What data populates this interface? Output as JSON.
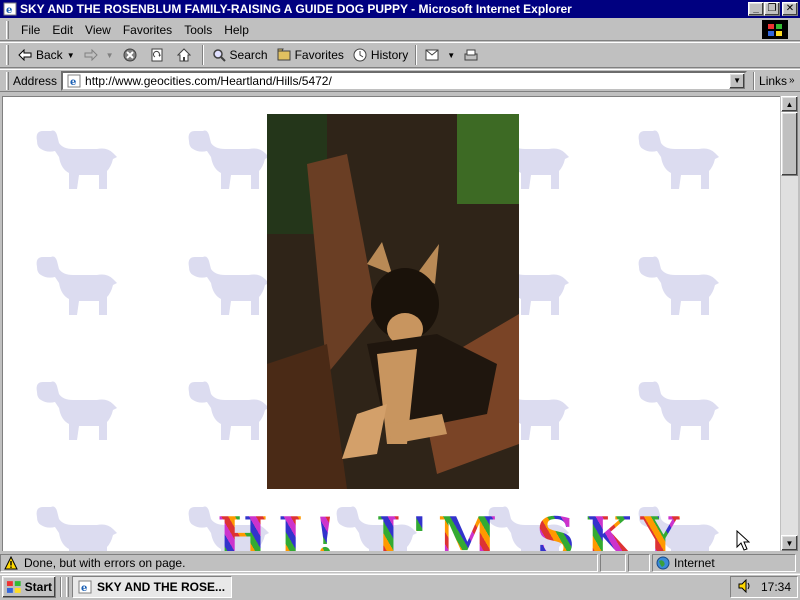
{
  "window": {
    "title": "SKY AND THE ROSENBLUM FAMILY-RAISING A GUIDE DOG PUPPY - Microsoft Internet Explorer",
    "minimize": "_",
    "maximize": "❐",
    "close": "✕"
  },
  "menu": {
    "items": [
      {
        "label": "File",
        "icon": "none"
      },
      {
        "label": "Edit"
      },
      {
        "label": "View"
      },
      {
        "label": "Favorites"
      },
      {
        "label": "Tools"
      },
      {
        "label": "Help"
      }
    ]
  },
  "toolbar": {
    "back_label": "Back",
    "search_label": "Search",
    "favorites_label": "Favorites",
    "history_label": "History",
    "icons": [
      "back-arrow-icon",
      "forward-arrow-icon",
      "stop-icon",
      "refresh-icon",
      "home-icon",
      "search-icon",
      "favorites-icon",
      "history-icon",
      "mail-icon",
      "print-icon"
    ]
  },
  "address": {
    "label": "Address",
    "url": "http://www.geocities.com/Heartland/Hills/5472/",
    "links_label": "Links",
    "links_chevron": "»"
  },
  "page": {
    "heading": "HI! I'M SKY",
    "background_motif": "dog-silhouette-icon",
    "photo_subject": "german-shepherd-puppy"
  },
  "status": {
    "text": "Done, but with errors on page.",
    "zone": "Internet"
  },
  "taskbar": {
    "start_label": "Start",
    "task_label": "SKY AND THE ROSE...",
    "clock": "17:34"
  },
  "colors": {
    "titlebar": "#000080",
    "chrome": "#c0c0c0",
    "bg_dog": "#dcdcf0"
  }
}
